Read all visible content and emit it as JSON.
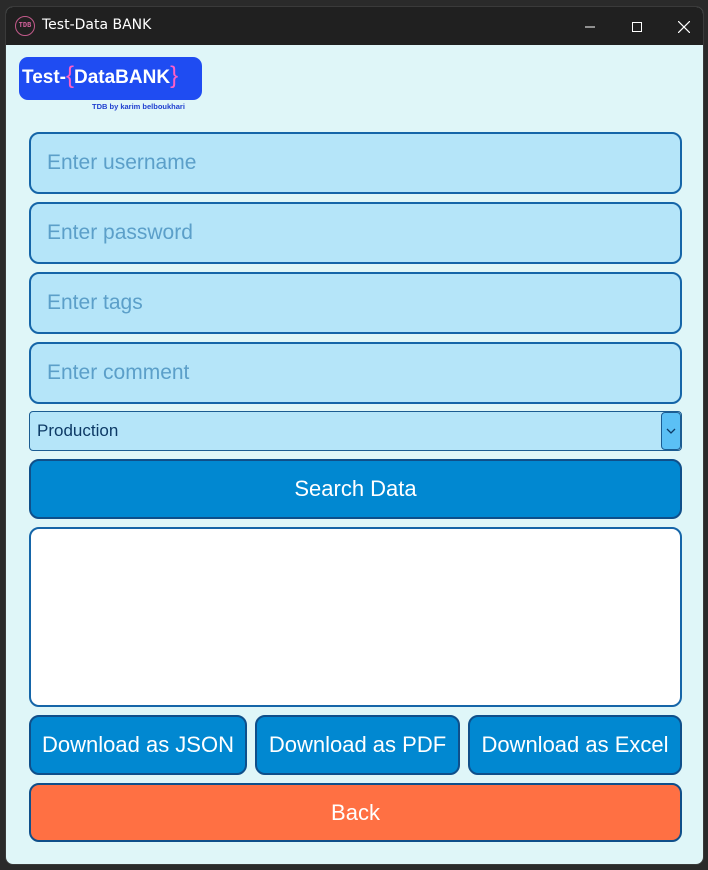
{
  "window": {
    "title": "Test-Data BANK",
    "icon_text": "TDB",
    "icon": "tdb-app-icon",
    "controls": {
      "minimize": "minimize-icon",
      "maximize": "maximize-icon",
      "close": "close-icon"
    }
  },
  "logo": {
    "prefix": "Test-",
    "brace_open": "{",
    "name": "DataBANK",
    "brace_close": "}",
    "subtitle": "TDB by karim belboukhari"
  },
  "form": {
    "username_placeholder": "Enter username",
    "password_placeholder": "Enter password",
    "tags_placeholder": "Enter tags",
    "comment_placeholder": "Enter comment",
    "environment_selected": "Production",
    "search_label": "Search Data"
  },
  "results": {
    "text": ""
  },
  "actions": {
    "json_label": "Download as JSON",
    "pdf_label": "Download as PDF",
    "excel_label": "Download as Excel",
    "back_label": "Back"
  },
  "colors": {
    "background": "#dff6f8",
    "input_bg": "#b5e5f9",
    "primary": "#0188d1",
    "back": "#ff7043",
    "logo_bg": "#1f4cf2",
    "logo_accent": "#ff5fc5"
  }
}
